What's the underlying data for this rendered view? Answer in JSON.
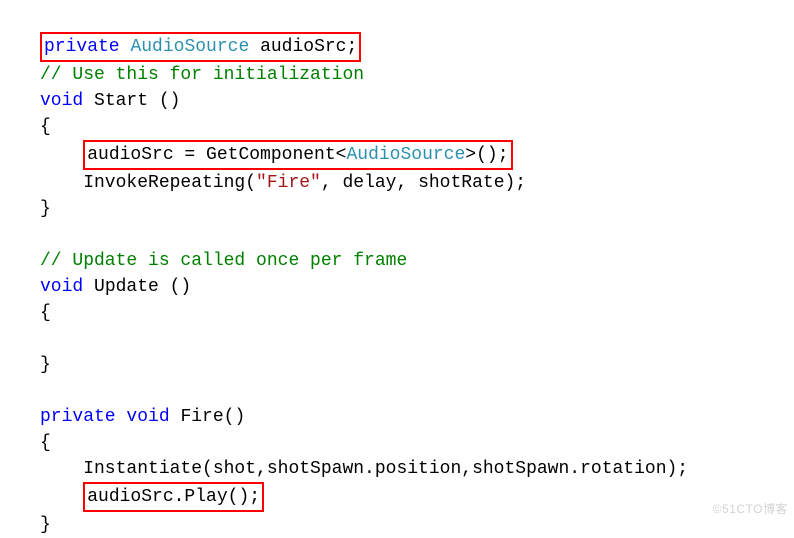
{
  "code": {
    "l1_private": "private",
    "l1_type": "AudioSource",
    "l1_rest": " audioSrc;",
    "l2_comment": "// Use this for initialization",
    "l3_void": "void",
    "l3_name": " Start ()",
    "l4_brace": "{",
    "l5_pre": "    ",
    "l5_a": "audioSrc = GetComponent<",
    "l5_type": "AudioSource",
    "l5_b": ">();",
    "l6_pre": "    InvokeRepeating(",
    "l6_str": "\"Fire\"",
    "l6_post": ", delay, shotRate);",
    "l7_brace": "}",
    "l9_comment": "// Update is called once per frame",
    "l10_void": "void",
    "l10_name": " Update ()",
    "l11_brace": "{",
    "l13_brace": "}",
    "l15_private": "private",
    "l15_void": " void",
    "l15_name": " Fire()",
    "l16_brace": "{",
    "l17_text": "    Instantiate(shot,shotSpawn.position,shotSpawn.rotation);",
    "l18_pre": "    ",
    "l18_box": "audioSrc.Play();",
    "l19_brace": "}"
  },
  "watermark": "©51CTO博客"
}
